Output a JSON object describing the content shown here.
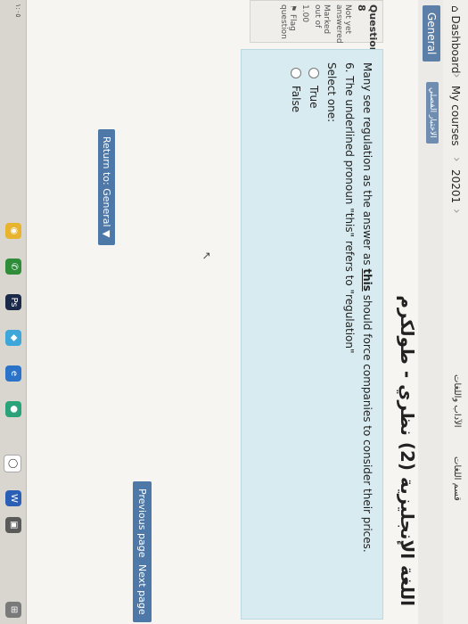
{
  "breadcrumbs": {
    "dashboard": "Dashboard",
    "my_courses": "My courses",
    "year": "20201",
    "dept": "قسم اللغات",
    "faculty": "الآداب واللغات"
  },
  "tabs": {
    "general": "General",
    "quiz": "الاختبار الفصلي"
  },
  "page": {
    "title": "اللغة الإنجليزية (2) نظري - طولكرم"
  },
  "question_info": {
    "number_label": "Question",
    "number": "8",
    "status": "Not yet answered",
    "marked_out_of_label": "Marked out of",
    "marked_out_of": "1.00",
    "flag_label": "Flag question"
  },
  "question": {
    "sentence": "Many see regulation as the answer as this should force companies to consider their prices.",
    "prompt": "6. The underlined pronoun \"this\" refers to \"regulation\"",
    "select_label": "Select one:",
    "options": [
      "True",
      "False"
    ]
  },
  "nav": {
    "previous": "Previous page",
    "next": "Next page",
    "return": "Return to: General"
  },
  "taskbar": {
    "time": "١:٠٥"
  },
  "colors": {
    "question_bg": "#d7ebf1",
    "button": "#4d78a8"
  }
}
